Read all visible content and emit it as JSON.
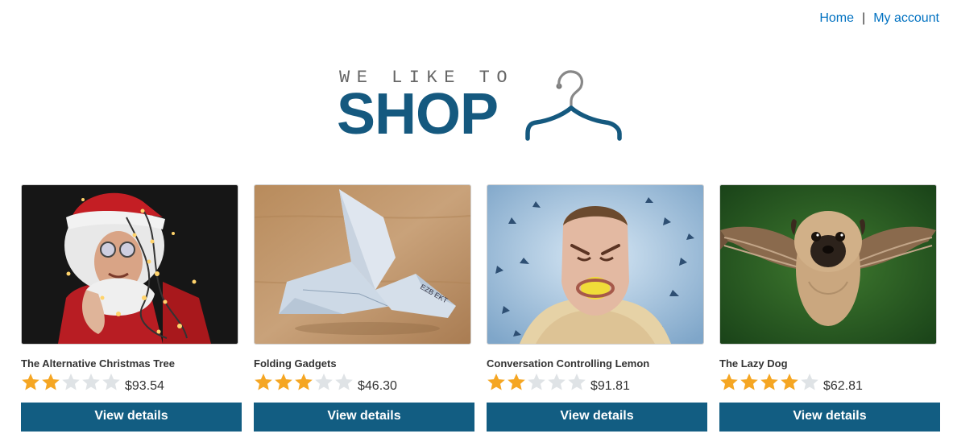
{
  "nav": {
    "home_label": "Home",
    "separator": "|",
    "account_label": "My account"
  },
  "logo": {
    "tagline": "WE LIKE TO",
    "wordmark": "SHOP",
    "icon": "coat-hanger-icon",
    "color": "#15597f"
  },
  "colors": {
    "link": "#0071c1",
    "button": "#125d82",
    "star_filled": "#f5a623",
    "star_empty": "#dfe3e6"
  },
  "products": [
    {
      "name": "The Alternative Christmas Tree",
      "rating": 2,
      "max_rating": 5,
      "price": "$93.54",
      "button_label": "View details",
      "image": "man-in-santa-costume-with-lights-photo"
    },
    {
      "name": "Folding Gadgets",
      "rating": 3,
      "max_rating": 5,
      "price": "$46.30",
      "button_label": "View details",
      "image": "origami-banknote-bird-photo"
    },
    {
      "name": "Conversation Controlling Lemon",
      "rating": 2,
      "max_rating": 5,
      "price": "$91.81",
      "button_label": "View details",
      "image": "man-with-lemon-in-mouth-photo"
    },
    {
      "name": "The Lazy Dog",
      "rating": 4,
      "max_rating": 5,
      "price": "$62.81",
      "button_label": "View details",
      "image": "pug-with-wings-photo"
    }
  ]
}
